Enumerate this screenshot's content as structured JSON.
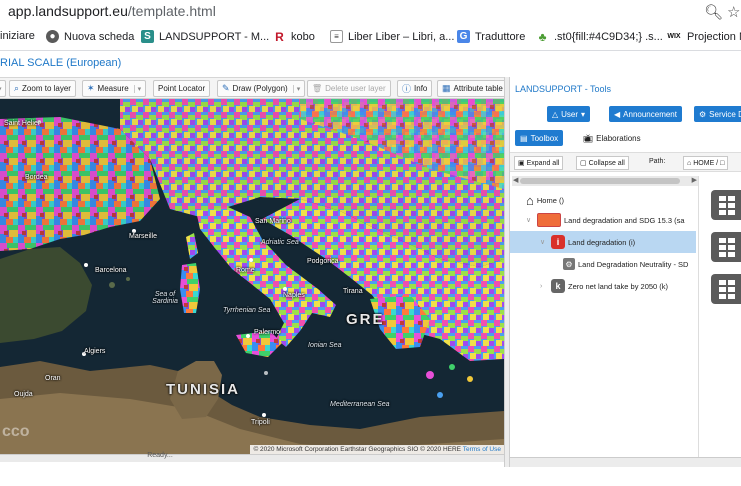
{
  "browser": {
    "url_host": "app.landsupport.eu",
    "url_path": "/template.html",
    "bookmarks": [
      {
        "label": "iniziare",
        "icon": "bookmark-icon"
      },
      {
        "label": "Nuova scheda",
        "icon": "globe-icon"
      },
      {
        "label": "LANDSUPPORT - M...",
        "icon": "landsupport-icon"
      },
      {
        "label": "kobo",
        "icon": "kobo-icon"
      },
      {
        "label": "Liber Liber – Libri, a...",
        "icon": "page-icon"
      },
      {
        "label": "Traduttore",
        "icon": "translate-icon"
      },
      {
        "label": ".st0{fill:#4C9D34;} .s...",
        "icon": "leaf-icon"
      },
      {
        "label": "Projection M",
        "icon": "wix-icon"
      }
    ]
  },
  "app": {
    "scale_title": "RIAL SCALE (European)"
  },
  "toolbar": {
    "zoom_to_layer": "Zoom to layer",
    "measure": "Measure",
    "point_locator": "Point Locator",
    "draw": "Draw (Polygon)",
    "delete_user_layer": "Delete user layer",
    "info": "Info",
    "attribute_table": "Attribute table"
  },
  "map": {
    "labels": {
      "saint_helier": "Saint Helier",
      "bordeaux": "Bordea",
      "marseille": "Marseille",
      "barcelona": "Barcelona",
      "san_marino": "San Marino",
      "adriatic_sea": "Adriatic Sea",
      "rome": "Rome",
      "podgorica": "Podgorica",
      "tirana": "Tirana",
      "naples": "Naples",
      "sea_of_sardinia": "Sea of Sardinia",
      "tyrrhenian_sea": "Tyrrhenian Sea",
      "palermo": "Palermo",
      "ionian_sea": "Ionian Sea",
      "algiers": "Algiers",
      "tunisia": "TUNISIA",
      "oran": "Oran",
      "tripoli": "Tripoli",
      "mediterranean_sea": "Mediterranean Sea",
      "oujda": "Oujda",
      "greece_partial": "GRE"
    },
    "attribution": "© 2020 Microsoft Corporation Earthstar Geographics SIO © 2020 HERE",
    "terms": "Terms of Use",
    "status": "Ready...",
    "corner_logo": "cco"
  },
  "panel": {
    "title": "LANDSUPPORT - Tools",
    "user_button": "User",
    "announcement_button": "Announcement",
    "service_button": "Service D",
    "tabs": {
      "toolbox": "Toolbox",
      "elaborations": "Elaborations"
    },
    "expand_all": "Expand all",
    "collapse_all": "Collapse all",
    "path_label": "Path:",
    "path_home": "HOME /",
    "tree": [
      {
        "label": "Home ()",
        "level": 0
      },
      {
        "label": "Land degradation and SDG 15.3 (sa",
        "level": 1
      },
      {
        "label": "Land degradation (i)",
        "level": 2,
        "selected": true
      },
      {
        "label": "Land Degradation Neutrality - SD",
        "level": 3
      },
      {
        "label": "Zero net land take by 2050 (k)",
        "level": 2
      }
    ]
  },
  "colors": {
    "accent": "#1f7bd0",
    "selected_row": "#b9d7f2",
    "map_sea": "#122330"
  }
}
